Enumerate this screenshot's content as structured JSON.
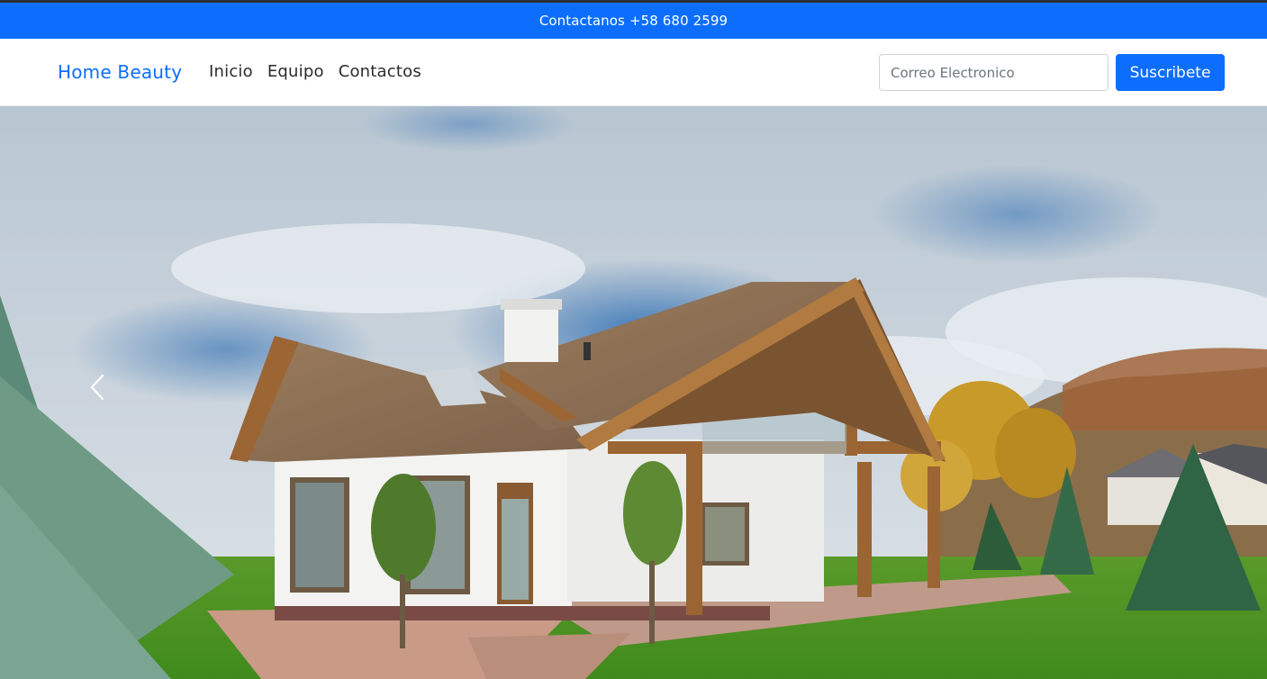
{
  "topbar": {
    "label": "Contactanos",
    "phone": "+58 680 2599"
  },
  "navbar": {
    "brand": "Home Beauty",
    "links": [
      {
        "label": "Inicio"
      },
      {
        "label": "Equipo"
      },
      {
        "label": "Contactos"
      }
    ],
    "email_placeholder": "Correo Electronico",
    "subscribe_label": "Suscribete"
  },
  "carousel": {
    "image_alt": "house-photo",
    "prev_icon": "chevron-left-icon"
  },
  "colors": {
    "primary": "#0d6efd",
    "text_dark": "#2b2b2b",
    "white": "#ffffff"
  }
}
